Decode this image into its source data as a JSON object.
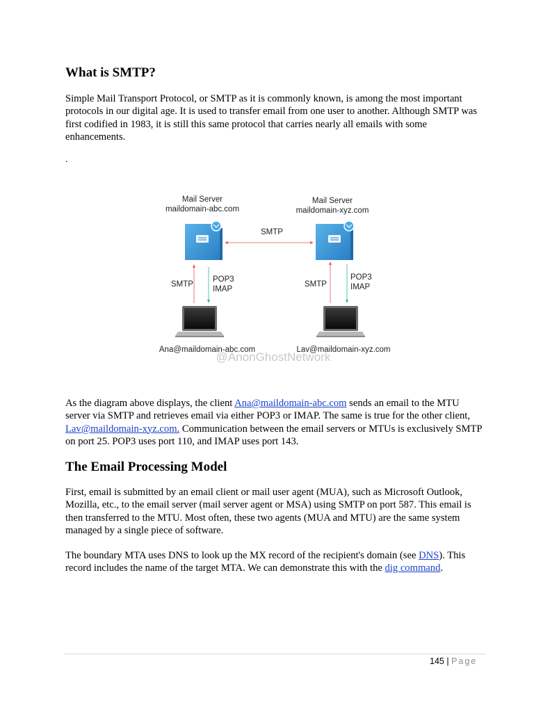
{
  "section1": {
    "heading": "What is SMTP?",
    "paragraph": "Simple Mail Transport Protocol, or SMTP as it is commonly known, is among the most important protocols in our digital age. It is used to transfer email from one user to another. Although SMTP was first codified in 1983, it is still this same protocol that carries nearly all emails with some enhancements.",
    "stray_dot": "."
  },
  "diagram": {
    "server_left": {
      "title": "Mail Server",
      "domain": "maildomain-abc.com"
    },
    "server_right": {
      "title": "Mail Server",
      "domain": "maildomain-xyz.com"
    },
    "between_servers_label": "SMTP",
    "left_up_label": "SMTP",
    "left_down_label1": "POP3",
    "left_down_label2": "IMAP",
    "right_up_label": "SMTP",
    "right_down_label1": "POP3",
    "right_down_label2": "IMAP",
    "client_left": "Ana@maildomain-abc.com",
    "client_right": "Lav@maildomain-xyz.com",
    "watermark": "@AnonGhostNetwork",
    "colors": {
      "server_blue": "#3a9bdc",
      "arrow_red": "#e05a5a",
      "arrow_teal": "#2bb5a0"
    }
  },
  "paragraph2": {
    "t1": "As the diagram above displays, the client ",
    "link1": "Ana@maildomain-abc.com",
    "t2": " sends an email to the MTU server via SMTP and retrieves email via either POP3 or IMAP. The same is true for the other client, ",
    "link2": "Lav@maildomain-xyz.com.",
    "t3": " Communication between the email servers or MTUs is exclusively SMTP on port 25. POP3 uses port 110, and IMAP uses port 143."
  },
  "section2": {
    "heading": "The Email Processing Model",
    "paragraph1": "First, email is submitted by an email client or mail user agent (MUA), such as Microsoft Outlook, Mozilla, etc., to the email server (mail server agent or MSA) using SMTP on port 587. This email is then transferred to the MTU. Most often, these two agents (MUA and MTU) are the same system managed by a single piece of software.",
    "p2_t1": "The boundary MTA uses DNS to look up the MX record of the recipient's domain (see ",
    "p2_link1": "DNS",
    "p2_t2": "). This record includes the name of the target MTA. We can demonstrate this with the ",
    "p2_link2": "dig command",
    "p2_t3": "."
  },
  "footer": {
    "page_number": "145",
    "separator": " | ",
    "page_word": "Page"
  }
}
